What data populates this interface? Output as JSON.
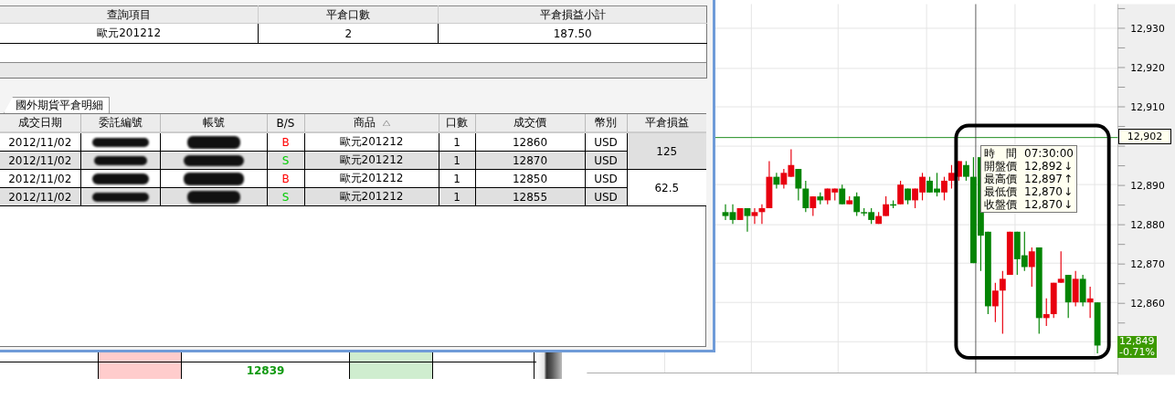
{
  "summary_table": {
    "columns": [
      "查詢項目",
      "平倉口數",
      "平倉損益小計"
    ],
    "rows": [
      [
        "歐元201212",
        "2",
        "187.50"
      ]
    ]
  },
  "tabs": [
    {
      "label": "國外期貨平倉明細",
      "selected": true
    }
  ],
  "detail_table": {
    "columns": [
      {
        "label": "成交日期",
        "sorted": false
      },
      {
        "label": "委託編號",
        "sorted": false
      },
      {
        "label": "帳號",
        "sorted": false
      },
      {
        "label": "B/S",
        "sorted": false
      },
      {
        "label": "商品",
        "sorted": true
      },
      {
        "label": "口數",
        "sorted": false
      },
      {
        "label": "成交價",
        "sorted": false
      },
      {
        "label": "幣別",
        "sorted": false
      },
      {
        "label": "平倉損益",
        "sorted": false
      }
    ],
    "groups": [
      {
        "pnl": "125",
        "shaded": true,
        "rows": [
          {
            "date": "2012/11/02",
            "side": "B",
            "color": "#ff0000",
            "product": "歐元201212",
            "qty": "1",
            "price": "12860",
            "currency": "USD",
            "shaded": false
          },
          {
            "date": "2012/11/02",
            "side": "S",
            "color": "#00cc00",
            "product": "歐元201212",
            "qty": "1",
            "price": "12870",
            "currency": "USD",
            "shaded": true
          }
        ]
      },
      {
        "pnl": "62.5",
        "shaded": false,
        "rows": [
          {
            "date": "2012/11/02",
            "side": "B",
            "color": "#ff0000",
            "product": "歐元201212",
            "qty": "1",
            "price": "12850",
            "currency": "USD",
            "shaded": false
          },
          {
            "date": "2012/11/02",
            "side": "S",
            "color": "#00cc00",
            "product": "歐元201212",
            "qty": "1",
            "price": "12855",
            "currency": "USD",
            "shaded": true
          }
        ]
      }
    ]
  },
  "quote_table": {
    "rows": [
      {
        "price": "12839"
      }
    ]
  },
  "chart": {
    "chart_data": {
      "type": "candlestick",
      "grid": true,
      "ylim": [
        12842,
        12936
      ],
      "ref_lines": [
        {
          "axis": "y",
          "value": 12902,
          "label": "12,902",
          "color": "#1a8a1a"
        }
      ],
      "ohlc": [
        [
          12883,
          12885,
          12881,
          12882
        ],
        [
          12883,
          12885,
          12880,
          12881
        ],
        [
          12881,
          12884,
          12881,
          12884
        ],
        [
          12884,
          12884,
          12878,
          12882
        ],
        [
          12882,
          12884,
          12880,
          12883
        ],
        [
          12883,
          12885,
          12880,
          12884
        ],
        [
          12884,
          12896,
          12884,
          12892
        ],
        [
          12892,
          12893,
          12889,
          12890
        ],
        [
          12890,
          12894,
          12889,
          12893
        ],
        [
          12892,
          12899,
          12892,
          12895
        ],
        [
          12894,
          12894,
          12886,
          12889
        ],
        [
          12889,
          12891,
          12883,
          12884
        ],
        [
          12884,
          12887,
          12882,
          12887
        ],
        [
          12887,
          12888,
          12885,
          12886
        ],
        [
          12886,
          12889,
          12885,
          12889
        ],
        [
          12888,
          12889,
          12886,
          12889
        ],
        [
          12889,
          12890,
          12885,
          12885
        ],
        [
          12885,
          12887,
          12885,
          12886
        ],
        [
          12887,
          12888,
          12882,
          12883
        ],
        [
          12883,
          12884,
          12882,
          12883
        ],
        [
          12883,
          12884,
          12880,
          12881
        ],
        [
          12880,
          12883,
          12880,
          12882
        ],
        [
          12882,
          12887,
          12882,
          12885
        ],
        [
          12885,
          12886,
          12884,
          12885
        ],
        [
          12885,
          12891,
          12885,
          12890
        ],
        [
          12889,
          12889,
          12885,
          12886
        ],
        [
          12886,
          12889,
          12884,
          12889
        ],
        [
          12888,
          12893,
          12886,
          12892
        ],
        [
          12891,
          12892,
          12888,
          12888
        ],
        [
          12889,
          12893,
          12887,
          12888
        ],
        [
          12888,
          12892,
          12886,
          12891
        ],
        [
          12891,
          12895,
          12889,
          12893
        ],
        [
          12892,
          12896,
          12891,
          12896
        ],
        [
          12895,
          12896,
          12891,
          12892
        ],
        [
          12892,
          12897,
          12870,
          12870
        ],
        [
          12897,
          12897,
          12868,
          12877
        ],
        [
          12878,
          12878,
          12857,
          12859
        ],
        [
          12859,
          12865,
          12855,
          12863
        ],
        [
          12863,
          12868,
          12852,
          12866
        ],
        [
          12867,
          12878,
          12867,
          12878
        ],
        [
          12878,
          12878,
          12867,
          12871
        ],
        [
          12872,
          12878,
          12868,
          12869
        ],
        [
          12869,
          12874,
          12864,
          12873
        ],
        [
          12874,
          12874,
          12852,
          12856
        ],
        [
          12856,
          12861,
          12854,
          12857
        ],
        [
          12857,
          12865,
          12856,
          12865
        ],
        [
          12865,
          12873,
          12865,
          12866
        ],
        [
          12867,
          12867,
          12856,
          12860
        ],
        [
          12860,
          12868,
          12859,
          12866
        ],
        [
          12866,
          12867,
          12859,
          12860
        ],
        [
          12860,
          12864,
          12856,
          12861
        ],
        [
          12860,
          12860,
          12847,
          12849
        ]
      ],
      "yticks": [
        {
          "value": 12930,
          "label": "12,930"
        },
        {
          "value": 12920,
          "label": "12,920"
        },
        {
          "value": 12910,
          "label": "12,910"
        },
        {
          "value": 12890,
          "label": "12,890"
        },
        {
          "value": 12880,
          "label": "12,880"
        },
        {
          "value": 12870,
          "label": "12,870"
        },
        {
          "value": 12860,
          "label": "12,860"
        }
      ]
    },
    "last_price": "12,849",
    "last_change": "-0.71%",
    "tooltip": [
      {
        "label": "時　間",
        "value": "07:30:00"
      },
      {
        "label": "開盤價",
        "value": "12,892",
        "arrow": "↓"
      },
      {
        "label": "最高價",
        "value": "12,897",
        "arrow": "↑"
      },
      {
        "label": "最低價",
        "value": "12,870",
        "arrow": "↓"
      },
      {
        "label": "收盤價",
        "value": "12,870",
        "arrow": "↓"
      }
    ]
  }
}
